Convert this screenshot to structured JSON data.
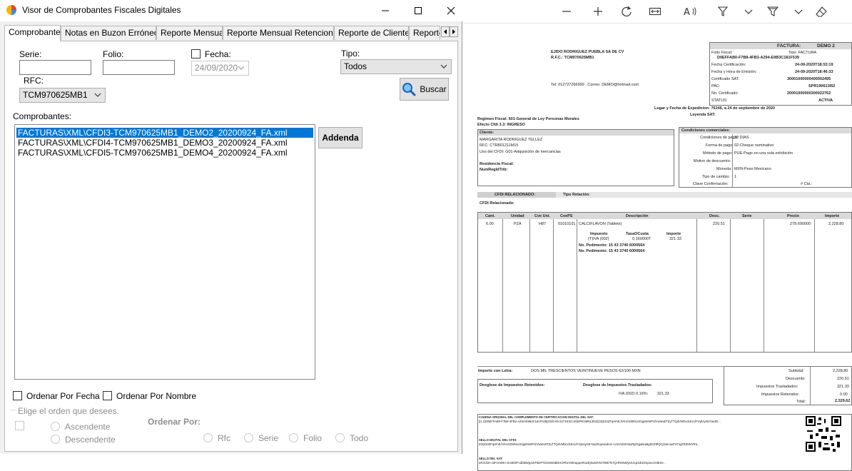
{
  "window": {
    "title": "Visor de Comprobantes Fiscales Digitales",
    "tabs": [
      {
        "label": "Comprobantes",
        "active": true
      },
      {
        "label": "Notas en Buzon Erróneos"
      },
      {
        "label": "Reporte Mensual"
      },
      {
        "label": "Reporte Mensual Retenciones"
      },
      {
        "label": "Reporte de Clientes"
      },
      {
        "label": "Reporte"
      }
    ]
  },
  "form": {
    "serie_label": "Serie:",
    "folio_label": "Folio:",
    "fecha_label": "Fecha:",
    "fecha_value": "24/09/2020",
    "tipo_label": "Tipo:",
    "tipo_value": "Todos",
    "rfc_label": "RFC:",
    "rfc_value": "TCM970625MB1",
    "buscar_label": "Buscar",
    "comprobantes_label": "Comprobantes:",
    "addenda_label": "Addenda",
    "files": [
      "FACTURAS\\XML\\CFDI3-TCM970625MB1_DEMO2_20200924_FA.xml",
      "FACTURAS\\XML\\CFDI4-TCM970625MB1_DEMO3_20200924_FA.xml",
      "FACTURAS\\XML\\CFDI5-TCM970625MB1_DEMO4_20200924_FA.xml"
    ],
    "ordenar_fecha": "Ordenar Por Fecha",
    "ordenar_nombre": "Ordenar Por Nombre",
    "elige_orden": "Elige el orden que desees.",
    "ascendente": "Ascendente",
    "descendente": "Descendente",
    "ordenar_por": "Ordenar Por:",
    "rfc_opt": "Rfc",
    "serie_opt": "Serie",
    "folio_opt": "Folio",
    "todo_opt": "Todo"
  },
  "invoice": {
    "factura_label": "FACTURA:",
    "factura_serie": "DEMO 2",
    "folio_fiscal_label": "Folio Fiscal:",
    "tipo_label": "Tipo: FACTURA",
    "uuid": "D0EFFAB0-F7B8-4FB3-A294-E9B3C181F539",
    "fecha_cert_label": "Fecha Certificación:",
    "fecha_cert": "24-09-2020T18:53:19",
    "fecha_emision_label": "Fecha y Hora de Emisión:",
    "fecha_emision": "24-09-2020T18:46:33",
    "cert_sat_label": "Certificado SAT:",
    "cert_sat": "30001000000400002495",
    "pac_label": "PAC:",
    "pac": "SPR190613I52",
    "no_cert_label": "No. Certificado:",
    "no_cert": "20001000000300022762",
    "status_label": "STATUS:",
    "status": "ACTIVA",
    "emisor_nombre": "EJIDO RODRIGUEZ PUEBLA SA DE CV",
    "emisor_rfc": "R.F.C.: TCM970625MB1",
    "emisor_tel": "Tel: 012727266999 , Correo: DEMO@hotmail.com",
    "lugar": "Lugar y Fecha de Expedicion: 76246, a 24 de septiembre de 2020",
    "leyenda": "Leyenda SAT:",
    "regimen": "Regimen Fiscal: 601-General de Ley Personas Morales",
    "efecto": "Efecto Cfdi 3.3: INGRESO",
    "cliente_label": "Cliente:",
    "cliente_nombre": "MARGARITA RODRIGUEZ TELLEZ",
    "cliente_rfc": "RFC: CTR801211M15",
    "uso_cfdi": "Uso del CFDI: G01-Adquisición de mercancias",
    "residencia": "Residencia Fiscal:",
    "numreg": "NumRegIdTrib:",
    "condiciones_title": "Condiciones comerciales:",
    "cond_pago_label": "Condiciones de pago:",
    "cond_pago": "30 DIAS",
    "forma_pago_label": "Forma de pago:",
    "forma_pago": "02-Cheque nominativo",
    "metodo_pago_label": "Método de pago:",
    "metodo_pago": "PUE-Pago en una sola exhibición",
    "motivo_label": "Motivo de descuento:",
    "moneda_label": "Moneda:",
    "moneda": "MXN-Peso Mexicano",
    "tipo_cambio_label": "Tipo de cambio:",
    "tipo_cambio": "1",
    "clave_conf_label": "Clave  Confirmación:",
    "cta_label": "# Cta.:",
    "cfdi_rel_label": "CFDI RELACIONADO:",
    "tipo_rel_label": "Tipo Relación:",
    "cfdi_relacionado": "CFDI Relacionado:",
    "headers": [
      "Cant.",
      "Unidad",
      "Cve Uni.",
      "CvePS",
      "Descripción",
      "Desc.",
      "Serie",
      "Precio",
      "Importe"
    ],
    "item": {
      "cant": "6.00",
      "unidad": "PZA",
      "cveuni": "H87",
      "cveps": "01010101",
      "desc": "CALCIFLAVON (Tablets)",
      "descuento": "220.51",
      "precio": "278.600000",
      "importe": "2,228.80"
    },
    "imp_header": "Impuesto",
    "tasa_header": "TasaOCuota",
    "importe_header": "Importe",
    "imp_name": "(T)IVA (002)",
    "imp_tasa": "0.160000T",
    "imp_importe": "321.33",
    "pedimento1": "No. Pedimento: 15  43  3740  6000564",
    "pedimento2": "No. Pedimento: 15  43  3740  6000564",
    "importe_letra_label": "Importe con Letra:",
    "importe_letra": "DOS MIL TRESCIENTOS VEINTINUEVE PESOS 62/100 MXN",
    "subtotal_label": "Subtotal:",
    "subtotal": "2,228.80",
    "descuento_label": "Descuento:",
    "descuento": "220.51",
    "traslados_label": "Impuestos Trasladados:",
    "traslados": "321.33",
    "retenidos_label": "Impuestos Retenidos:",
    "retenidos": "0.00",
    "total_label": "Total:",
    "total": "2,329.62",
    "desglose_ret": "Desglose de Impuestos Retenidos:",
    "desglose_tras": "Desglose de Impuestos Trasladados:",
    "desglose_tras_line": "IVA (002) 0.16%:",
    "desglose_tras_val": "321.33",
    "cadena_label": "CADENA ORIGINAL DEL COMPLEMENTO DE CERTIFICACION DIGITAL DEL SAT:",
    "cadena_text": "||1.1|D0EFFAB0-F7B8-4FB3-A294-E9B3C181F539|2020-09-24T18:53:19|SPR190613I52|Z3QG0ZFqHFdLfVKvGDbRoxSSg8mWPrZVwWu0TZyTTQdVMDcdcEAdYVyksyrs57aoZ0...",
    "sello_cfdi_label": "SELLO DIGITAL DEL CFDI:",
    "sello_cfdi_text": "Z3QG0ZFqHFdLfVKvGDbRoxSSg8mWPrZVwWu0TZyTTQdVMDcdcEAdYVyksyrs57aoZ0opvuwko1+UmVoDZmkyRjdGgaNaMg5GZ6fQCj34enavP4TngFlDEWVRa...",
    "sello_sat_label": "SELLO DEL SAT:",
    "sello_sat_text": "eRJ1fz0+cdFzHWK+Gm8ShFcdbtkWg1WT5DPTDGWn9BDHOFbzVMHuppmRazEjNoWVkATBtKTe7QHFD6WiysX4cpS3lJGKpmc4HtE3V..."
  }
}
